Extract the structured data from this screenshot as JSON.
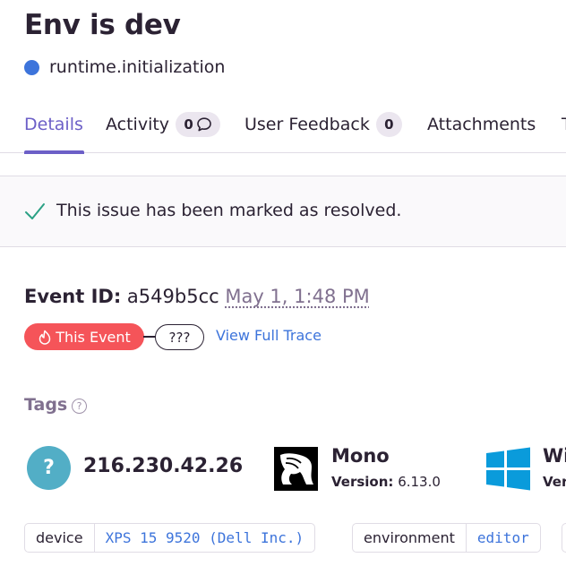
{
  "header": {
    "title": "Env is dev",
    "subtitle": "runtime.initialization",
    "level_color": "#3d74db"
  },
  "tabs": [
    {
      "label": "Details",
      "active": true
    },
    {
      "label": "Activity",
      "badge": "0"
    },
    {
      "label": "User Feedback",
      "badge": "0"
    },
    {
      "label": "Attachments"
    },
    {
      "label": "T"
    }
  ],
  "resolved": {
    "message": "This issue has been marked as resolved.",
    "icon": "checkmark-icon"
  },
  "event": {
    "id_label": "Event ID:",
    "id_value": "a549b5cc",
    "date": "May 1, 1:48 PM",
    "this_event_label": "This Event",
    "unknown_label": "???",
    "view_trace_label": "View Full Trace"
  },
  "tags": {
    "heading": "Tags",
    "help_icon": "question-mark-icon",
    "highlights": {
      "ip": "216.230.42.26",
      "runtime_name": "Mono",
      "runtime_version_label": "Version:",
      "runtime_version": "6.13.0",
      "os_name": "Wi",
      "os_version_fragment": "Ver"
    },
    "pills": [
      {
        "key": "device",
        "value": "XPS 15 9520 (Dell Inc.)"
      },
      {
        "key": "environment",
        "value": "editor"
      }
    ]
  },
  "colors": {
    "accent": "#6c5fc7",
    "link": "#3d74db",
    "this_event_bg": "#f55459",
    "ip_avatar_bg": "#52aec6",
    "windows_blue": "#0a9bdb",
    "resolved_check": "#2ba185"
  }
}
